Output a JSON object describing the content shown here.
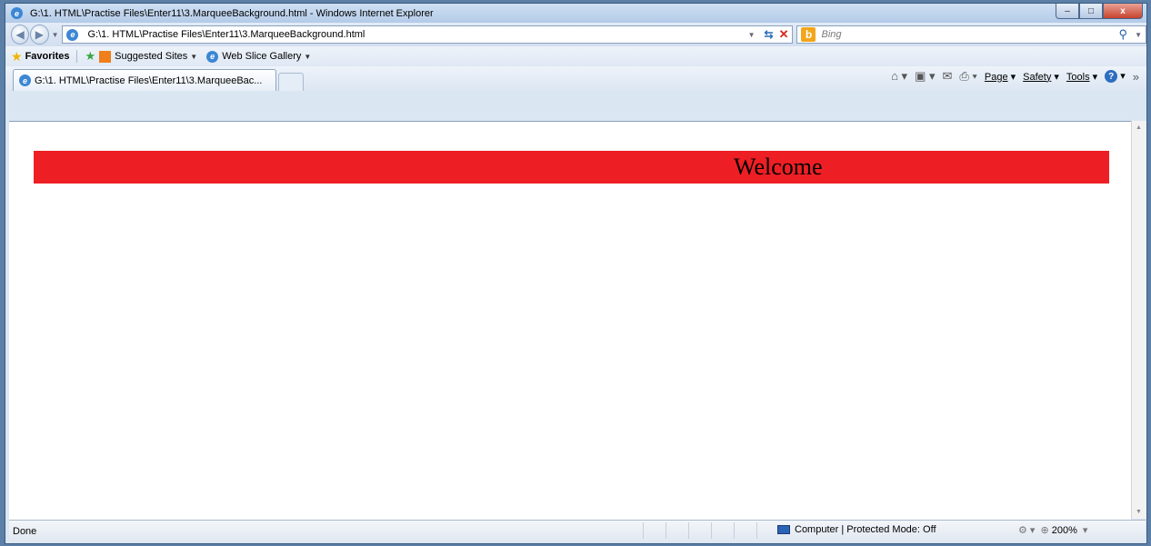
{
  "window": {
    "title": "G:\\1. HTML\\Practise Files\\Enter11\\3.MarqueeBackground.html - Windows Internet Explorer",
    "minimize": "‒",
    "maximize": "□",
    "close": "x"
  },
  "nav": {
    "address": "G:\\1. HTML\\Practise Files\\Enter11\\3.MarqueeBackground.html",
    "search_placeholder": "Bing"
  },
  "favorites": {
    "favorites_label": "Favorites",
    "suggested_sites": "Suggested Sites",
    "web_slice_gallery": "Web Slice Gallery"
  },
  "tabs": [
    {
      "label": "G:\\1. HTML\\Practise Files\\Enter11\\3.MarqueeBac..."
    }
  ],
  "commands": {
    "page": "Page",
    "safety": "Safety",
    "tools": "Tools"
  },
  "page": {
    "marquee_text": "Welcome",
    "marquee_color": "#ee1f24"
  },
  "status": {
    "text": "Done",
    "zone": "Computer | Protected Mode: Off",
    "zoom": "200%"
  },
  "colors": {
    "accent": "#3b5a80",
    "close_button": "#c7432c"
  }
}
